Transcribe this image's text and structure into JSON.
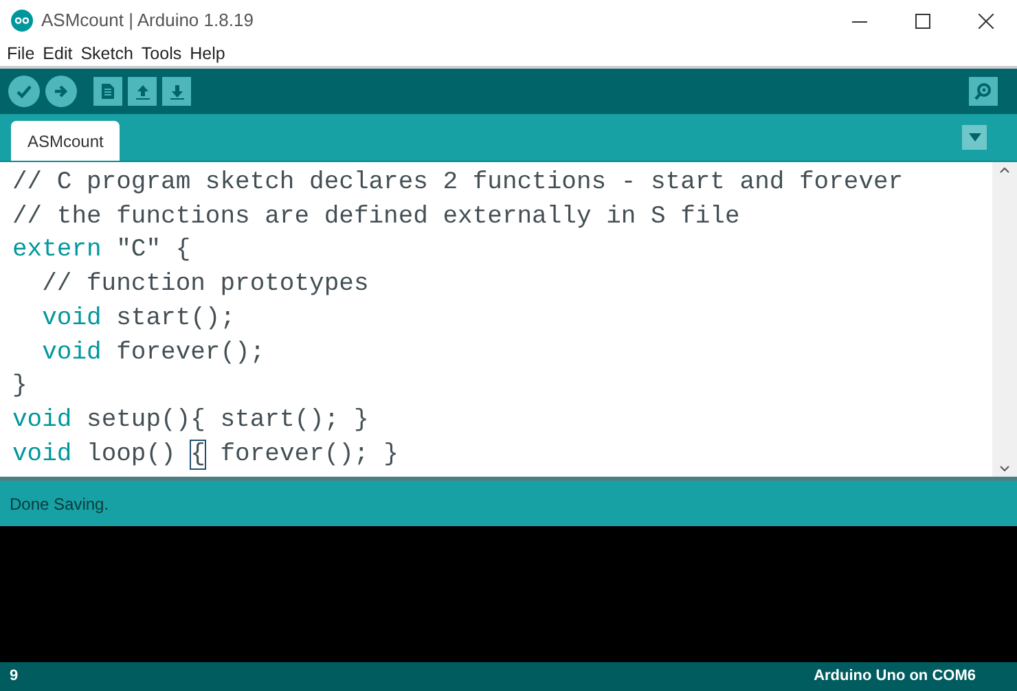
{
  "window": {
    "title": "ASMcount | Arduino 1.8.19"
  },
  "menu": [
    "File",
    "Edit",
    "Sketch",
    "Tools",
    "Help"
  ],
  "tabs": [
    {
      "label": "ASMcount",
      "selected": true
    }
  ],
  "editor": {
    "lines": [
      {
        "tokens": [
          {
            "kind": "comment",
            "text": "// C program sketch declares 2 functions - start and forever"
          }
        ]
      },
      {
        "tokens": [
          {
            "kind": "comment",
            "text": "// the functions are defined externally in S file"
          }
        ]
      },
      {
        "tokens": [
          {
            "kind": "keyword",
            "text": "extern"
          },
          {
            "kind": "plain",
            "text": " \"C\" {"
          }
        ]
      },
      {
        "tokens": [
          {
            "kind": "comment",
            "text": "  // function prototypes"
          }
        ]
      },
      {
        "tokens": [
          {
            "kind": "keyword",
            "text": "  void"
          },
          {
            "kind": "plain",
            "text": " start();"
          }
        ]
      },
      {
        "tokens": [
          {
            "kind": "keyword",
            "text": "  void"
          },
          {
            "kind": "plain",
            "text": " forever();"
          }
        ]
      },
      {
        "tokens": [
          {
            "kind": "plain",
            "text": "}"
          }
        ]
      },
      {
        "tokens": [
          {
            "kind": "keyword",
            "text": "void"
          },
          {
            "kind": "plain",
            "text": " setup(){ start(); }"
          }
        ]
      },
      {
        "tokens": [
          {
            "kind": "keyword",
            "text": "void"
          },
          {
            "kind": "plain",
            "text": " loop() "
          },
          {
            "kind": "bracket-match",
            "text": "{"
          },
          {
            "kind": "plain",
            "text": " forever(); }"
          }
        ]
      }
    ]
  },
  "message": "Done Saving.",
  "status_bar": {
    "line": "9",
    "board": "Arduino Uno on COM6"
  }
}
